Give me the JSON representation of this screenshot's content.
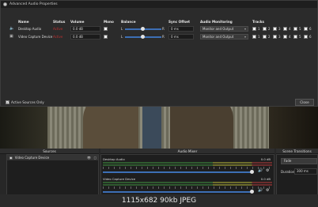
{
  "dialog": {
    "title": "Advanced Audio Properties",
    "headers": {
      "name": "Name",
      "status": "Status",
      "volume": "Volume",
      "mono": "Mono",
      "balance": "Balance",
      "sync_offset": "Sync Offset",
      "monitoring": "Audio Monitoring",
      "tracks": "Tracks"
    },
    "rows": [
      {
        "name": "Desktop Audio",
        "status": "Active",
        "volume": "0.0 dB",
        "balance_l": "L",
        "balance_r": "R",
        "sync": "0 ms",
        "monitoring": "Monitor and Output"
      },
      {
        "name": "Video Capture Device",
        "status": "Active",
        "volume": "0.0 dB",
        "balance_l": "L",
        "balance_r": "R",
        "sync": "0 ms",
        "monitoring": "Monitor and Output"
      }
    ],
    "track_numbers": [
      "1",
      "2",
      "3",
      "4",
      "5",
      "6"
    ],
    "active_only_label": "Active Sources Only",
    "close_label": "Close"
  },
  "docks": {
    "sources_title": "Sources",
    "mixer_title": "Audio Mixer",
    "transitions_title": "Scene Transitions",
    "sources": [
      {
        "name": "Video Capture Device"
      }
    ],
    "mixer": [
      {
        "name": "Desktop Audio",
        "db": "0.0 dB"
      },
      {
        "name": "Video Capture Device",
        "db": "0.0 dB"
      }
    ],
    "transition": "Fade",
    "duration_label": "Duration",
    "duration_value": "300 ms"
  },
  "banner": "1115x682 90kb JPEG"
}
